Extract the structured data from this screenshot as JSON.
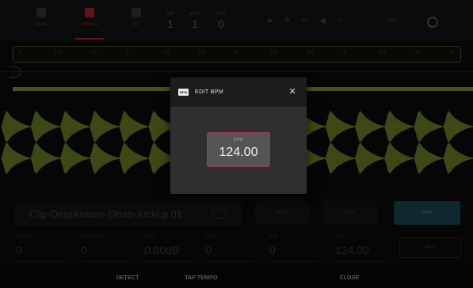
{
  "toolbar": {
    "tabs": [
      {
        "label": "MAIN"
      },
      {
        "label": "SAMPLE"
      },
      {
        "label": "MIX"
      }
    ],
    "counters": [
      {
        "label": "BAR",
        "value": "1"
      },
      {
        "label": "BEAT",
        "value": "1"
      },
      {
        "label": "TICK",
        "value": "0"
      }
    ],
    "edit_label": "EDIT"
  },
  "ruler": {
    "ticks": [
      "1",
      "1.3",
      "1.5",
      "2",
      "2.3",
      "2.5",
      "3",
      "3.3",
      "3.5",
      "4",
      "4.3",
      "4.5",
      "5"
    ]
  },
  "clip": {
    "name": "Clip-DeepHouse-Drum-KickLp 01",
    "buttons": {
      "resize": "RESIZE",
      "sync": "SYNC",
      "warp": "WARP"
    }
  },
  "params": [
    {
      "label": "REGION",
      "value": "0"
    },
    {
      "label": "PAD REGION",
      "value": "0"
    },
    {
      "label": "GAIN",
      "value": "0.00dB"
    },
    {
      "label": "TUNE",
      "value": "0"
    },
    {
      "label": "FINE",
      "value": "0"
    },
    {
      "label": "BPM",
      "value": "124.00"
    }
  ],
  "save_label": "SAVE",
  "footer": {
    "detect": "DETECT",
    "tap_tempo": "TAP TEMPO",
    "close": "CLOSE"
  },
  "modal": {
    "logo": "BPM",
    "title": "EDIT BPM",
    "close_icon": "×",
    "field_label": "BPM",
    "field_value": "124.00"
  },
  "colors": {
    "waveform": "#7f9a2f",
    "accent_red": "#c0202c",
    "modal_bg": "#2f2f2f",
    "field_border": "#a4384a",
    "warp_teal": "#1d4a57"
  }
}
